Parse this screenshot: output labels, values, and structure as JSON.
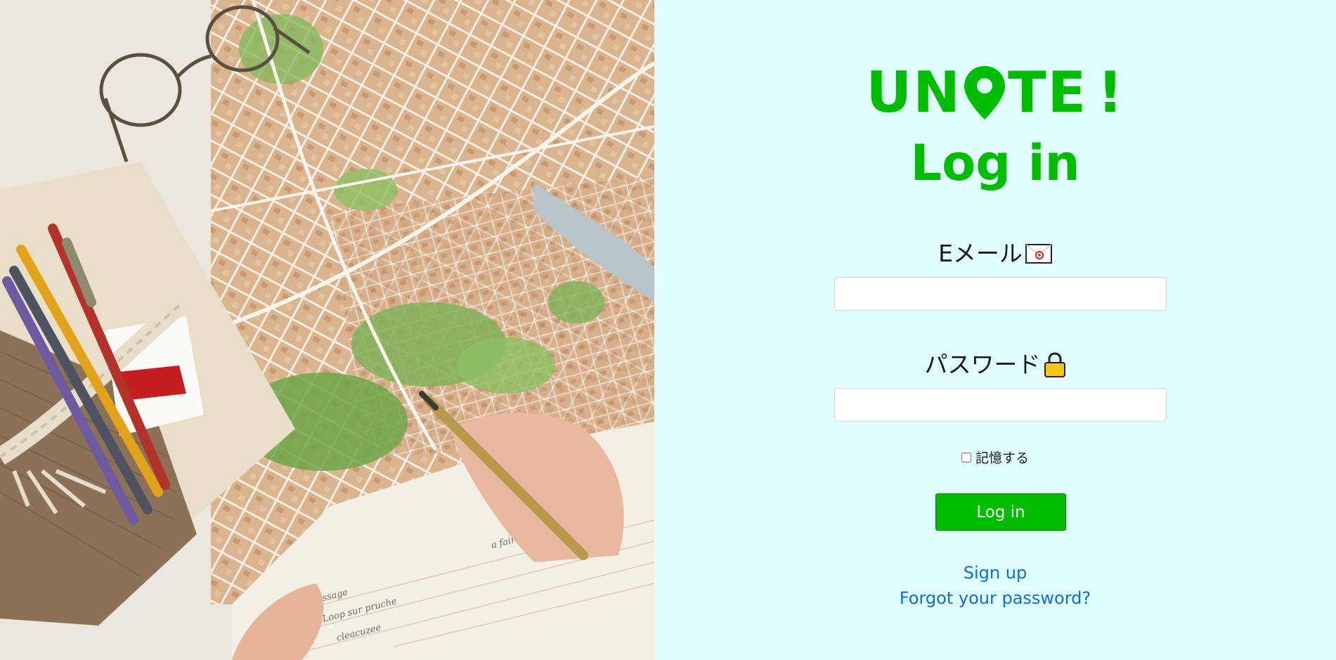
{
  "brand": {
    "logo_text_before": "UN",
    "logo_text_after": "TE",
    "logo_exclaim": "!",
    "logo_pin_icon": "map-pin-icon",
    "accent_color": "#00bd00"
  },
  "page": {
    "title": "Log in",
    "background_color": "#e1fefe"
  },
  "form": {
    "email_label": "Eメール",
    "email_icon": "envelope-icon",
    "email_value": "",
    "email_placeholder": "",
    "password_label": "パスワード",
    "password_icon": "lock-icon",
    "password_value": "",
    "password_placeholder": "",
    "remember_label": "記憶する",
    "remember_checked": false,
    "submit_label": "Log in"
  },
  "links": {
    "signup": "Sign up",
    "forgot_password": "Forgot your password?",
    "link_color": "#0a6fd6"
  },
  "hero_image": {
    "description_icon": "map-photo"
  }
}
